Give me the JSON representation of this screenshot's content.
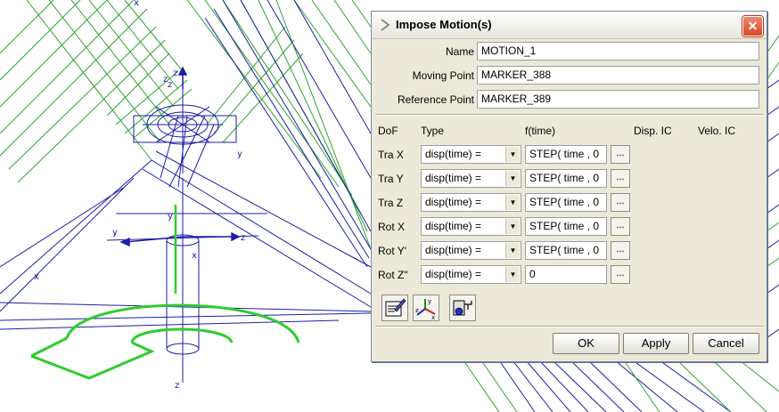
{
  "dialog": {
    "title": "Impose Motion(s)",
    "close_glyph": "✕",
    "fields": {
      "name_label": "Name",
      "name_value": "MOTION_1",
      "moving_label": "Moving Point",
      "moving_value": "MARKER_388",
      "reference_label": "Reference Point",
      "reference_value": "MARKER_389"
    },
    "headers": {
      "dof": "DoF",
      "type": "Type",
      "ftime": "f(time)",
      "disp_ic": "Disp. IC",
      "velo_ic": "Velo. IC"
    },
    "rows": [
      {
        "dof": "Tra X",
        "type": "disp(time) =",
        "ftime": "STEP( time , 0"
      },
      {
        "dof": "Tra Y",
        "type": "disp(time) =",
        "ftime": "STEP( time , 0"
      },
      {
        "dof": "Tra Z",
        "type": "disp(time) =",
        "ftime": "STEP( time , 0"
      },
      {
        "dof": "Rot X",
        "type": "disp(time) =",
        "ftime": "STEP( time , 0"
      },
      {
        "dof": "Rot Y'",
        "type": "disp(time) =",
        "ftime": "STEP( time , 0"
      },
      {
        "dof": "Rot Z\"",
        "type": "disp(time) =",
        "ftime": "0"
      }
    ],
    "dots_label": "...",
    "buttons": {
      "ok": "OK",
      "apply": "Apply",
      "cancel": "Cancel"
    }
  },
  "viewport": {
    "axis_labels": [
      "x",
      "y",
      "z"
    ]
  }
}
